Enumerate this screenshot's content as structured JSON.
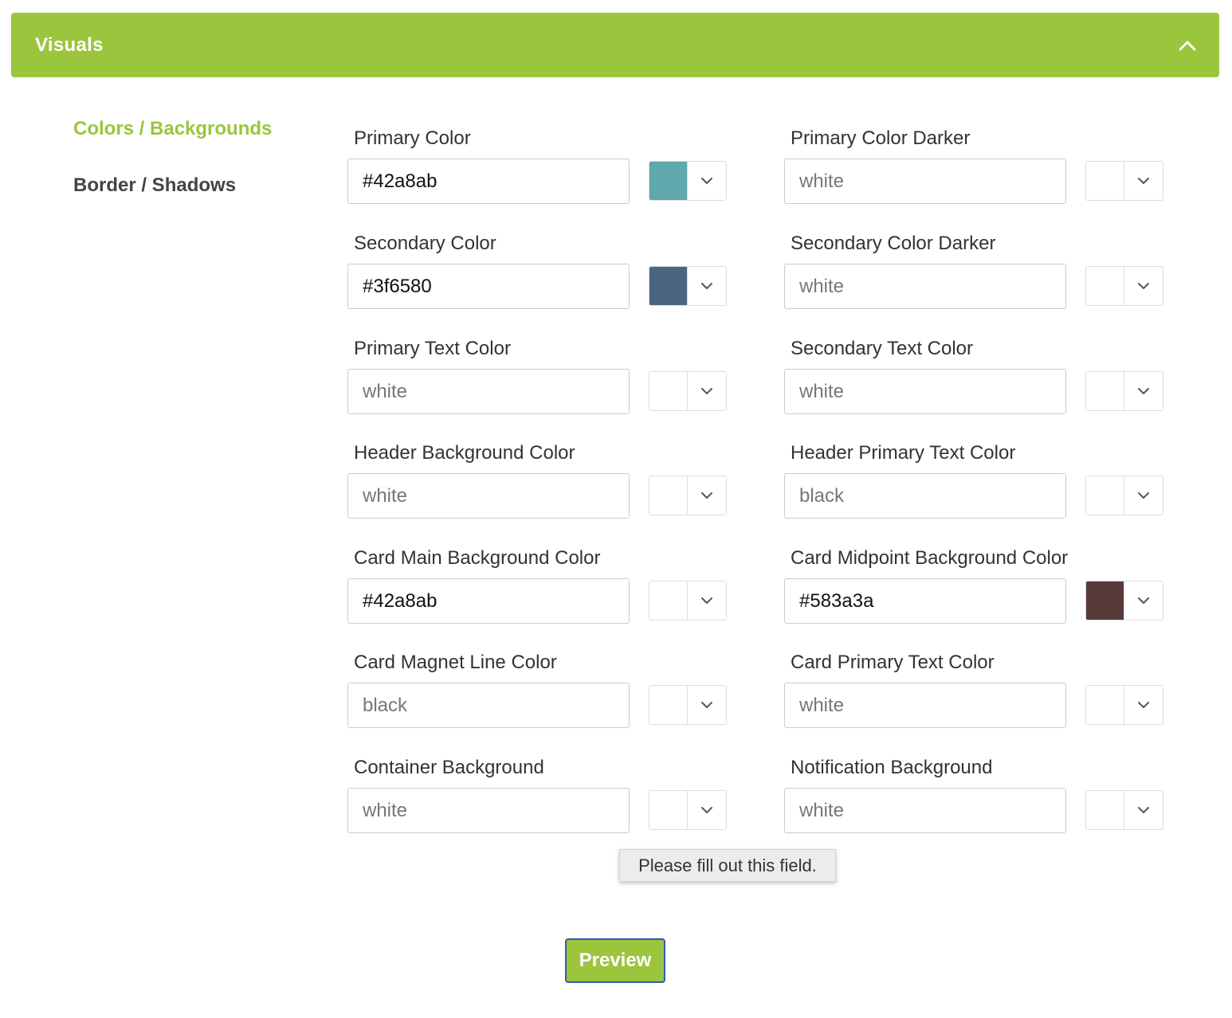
{
  "panel": {
    "title": "Visuals"
  },
  "sidenav": {
    "items": [
      {
        "label": "Colors / Backgrounds"
      },
      {
        "label": "Border / Shadows"
      }
    ]
  },
  "colors": {
    "accent": "#9bc53d",
    "focus_outline": "#2f5bb5"
  },
  "fields": [
    {
      "label": "Primary Color",
      "value": "#42a8ab",
      "placeholder": "",
      "swatch": "#5fa8ab"
    },
    {
      "label": "Primary Color Darker",
      "value": "",
      "placeholder": "white",
      "swatch": "#ffffff"
    },
    {
      "label": "Secondary Color",
      "value": "#3f6580",
      "placeholder": "",
      "swatch": "#4a6580"
    },
    {
      "label": "Secondary Color Darker",
      "value": "",
      "placeholder": "white",
      "swatch": "#ffffff"
    },
    {
      "label": "Primary Text Color",
      "value": "",
      "placeholder": "white",
      "swatch": "#ffffff"
    },
    {
      "label": "Secondary Text Color",
      "value": "",
      "placeholder": "white",
      "swatch": "#ffffff"
    },
    {
      "label": "Header Background Color",
      "value": "",
      "placeholder": "white",
      "swatch": "#ffffff"
    },
    {
      "label": "Header Primary Text Color",
      "value": "",
      "placeholder": "black",
      "swatch": "#ffffff"
    },
    {
      "label": "Card Main Background Color",
      "value": "#42a8ab",
      "placeholder": "",
      "swatch": "#ffffff"
    },
    {
      "label": "Card Midpoint Background Color",
      "value": "#583a3a",
      "placeholder": "",
      "swatch": "#583a3a"
    },
    {
      "label": "Card Magnet Line Color",
      "value": "",
      "placeholder": "black",
      "swatch": "#ffffff"
    },
    {
      "label": "Card Primary Text Color",
      "value": "",
      "placeholder": "white",
      "swatch": "#ffffff"
    },
    {
      "label": "Container Background",
      "value": "",
      "placeholder": "white",
      "swatch": "#ffffff"
    },
    {
      "label": "Notification Background",
      "value": "",
      "placeholder": "white",
      "swatch": "#ffffff"
    }
  ],
  "tooltip": {
    "text": "Please fill out this field."
  },
  "preview_button": {
    "label": "Preview"
  },
  "icons": {
    "collapse": "chevron-up-icon",
    "picker_toggle": "chevron-down-icon"
  }
}
